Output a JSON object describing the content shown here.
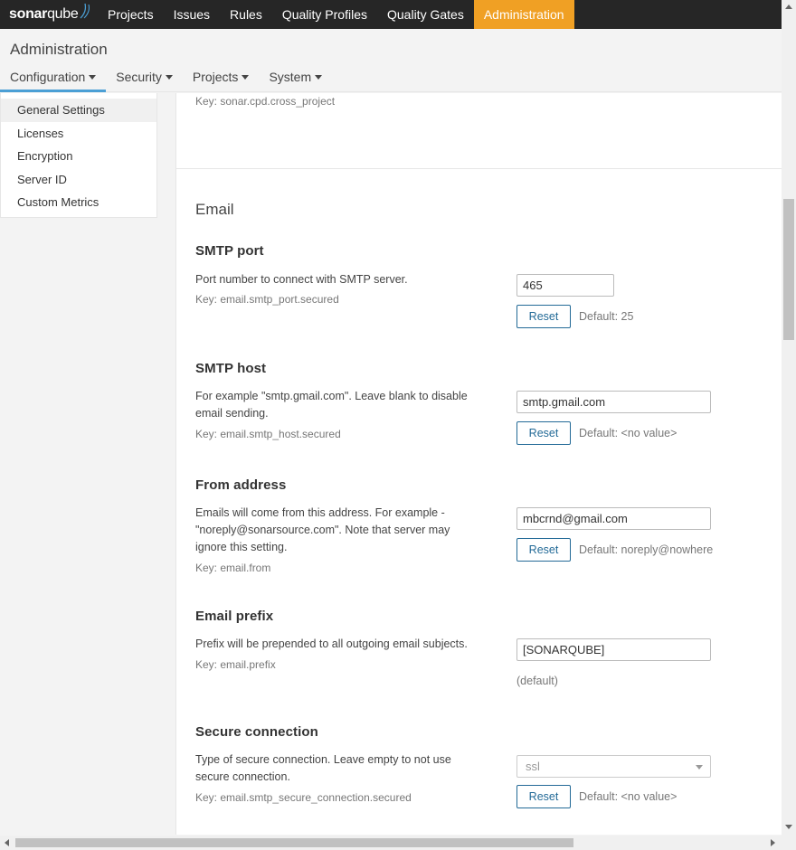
{
  "brand": {
    "logo_bold": "sonar",
    "logo_light": "qube"
  },
  "topnav": {
    "items": [
      {
        "label": "Projects"
      },
      {
        "label": "Issues"
      },
      {
        "label": "Rules"
      },
      {
        "label": "Quality Profiles"
      },
      {
        "label": "Quality Gates"
      },
      {
        "label": "Administration"
      }
    ],
    "active_color": "#f0a024"
  },
  "header": {
    "title": "Administration",
    "subnav": [
      {
        "label": "Configuration"
      },
      {
        "label": "Security"
      },
      {
        "label": "Projects"
      },
      {
        "label": "System"
      }
    ]
  },
  "sidebar": {
    "items": [
      {
        "label": "General Settings"
      },
      {
        "label": "Licenses"
      },
      {
        "label": "Encryption"
      },
      {
        "label": "Server ID"
      },
      {
        "label": "Custom Metrics"
      }
    ]
  },
  "main": {
    "previous_key": "Key: sonar.cpd.cross_project",
    "section_title": "Email",
    "settings": [
      {
        "title": "SMTP port",
        "description": "Port number to connect with SMTP server.",
        "key": "Key: email.smtp_port.secured",
        "value": "465",
        "reset_label": "Reset",
        "default": "Default: 25"
      },
      {
        "title": "SMTP host",
        "description": "For example \"smtp.gmail.com\". Leave blank to disable email sending.",
        "key": "Key: email.smtp_host.secured",
        "value": "smtp.gmail.com",
        "reset_label": "Reset",
        "default": "Default: <no value>"
      },
      {
        "title": "From address",
        "description": "Emails will come from this address. For example - \"noreply@sonarsource.com\". Note that server may ignore this setting.",
        "key": "Key: email.from",
        "value": "mbcrnd@gmail.com",
        "reset_label": "Reset",
        "default": "Default: noreply@nowhere"
      },
      {
        "title": "Email prefix",
        "description": "Prefix will be prepended to all outgoing email subjects.",
        "key": "Key: email.prefix",
        "value": "[SONARQUBE]",
        "default": "(default)"
      },
      {
        "title": "Secure connection",
        "description": "Type of secure connection. Leave empty to not use secure connection.",
        "key": "Key: email.smtp_secure_connection.secured",
        "value": "ssl",
        "reset_label": "Reset",
        "default": "Default: <no value>"
      }
    ]
  },
  "colors": {
    "accent_blue": "#236a97",
    "tab_underline": "#4b9fd5",
    "topbar": "#262626"
  }
}
